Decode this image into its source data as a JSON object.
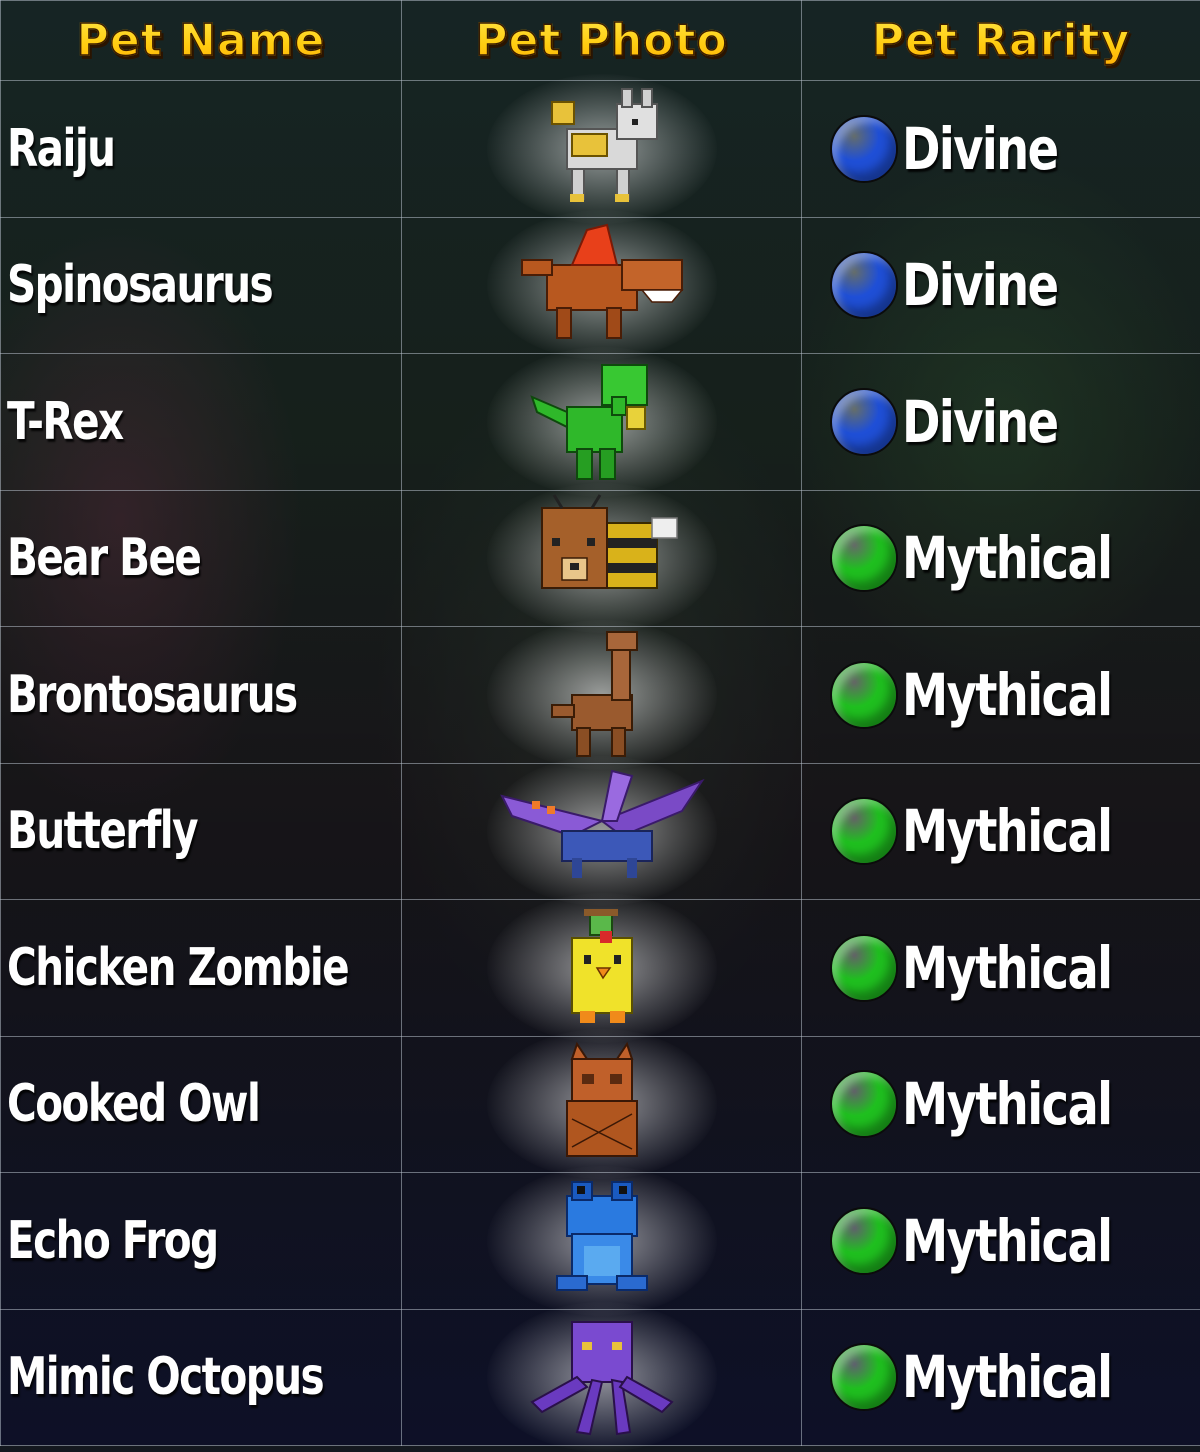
{
  "headers": {
    "name": "Pet Name",
    "photo": "Pet Photo",
    "rarity": "Pet Rarity"
  },
  "colors": {
    "divine": "#1f4fd6",
    "mythical": "#1fbf1f",
    "header": "#ffcc10"
  },
  "pets": [
    {
      "name": "Raiju",
      "rarity": "Divine",
      "tier": "divine",
      "icon": "raiju-icon"
    },
    {
      "name": "Spinosaurus",
      "rarity": "Divine",
      "tier": "divine",
      "icon": "spinosaurus-icon"
    },
    {
      "name": "T-Rex",
      "rarity": "Divine",
      "tier": "divine",
      "icon": "t-rex-icon"
    },
    {
      "name": "Bear Bee",
      "rarity": "Mythical",
      "tier": "mythical",
      "icon": "bear-bee-icon"
    },
    {
      "name": "Brontosaurus",
      "rarity": "Mythical",
      "tier": "mythical",
      "icon": "brontosaurus-icon"
    },
    {
      "name": "Butterfly",
      "rarity": "Mythical",
      "tier": "mythical",
      "icon": "butterfly-icon"
    },
    {
      "name": "Chicken Zombie",
      "rarity": "Mythical",
      "tier": "mythical",
      "icon": "chicken-zombie-icon"
    },
    {
      "name": "Cooked Owl",
      "rarity": "Mythical",
      "tier": "mythical",
      "icon": "cooked-owl-icon"
    },
    {
      "name": "Echo Frog",
      "rarity": "Mythical",
      "tier": "mythical",
      "icon": "echo-frog-icon"
    },
    {
      "name": "Mimic Octopus",
      "rarity": "Mythical",
      "tier": "mythical",
      "icon": "mimic-octopus-icon"
    }
  ]
}
